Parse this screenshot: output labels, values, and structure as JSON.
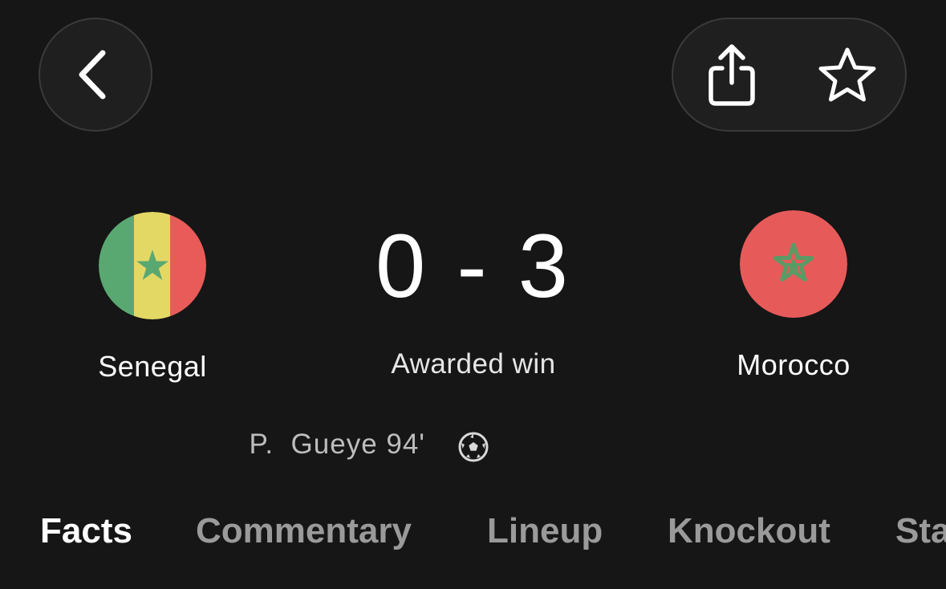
{
  "header": {
    "back_icon": "chevron-left-icon",
    "share_icon": "share-icon",
    "favorite_icon": "star-outline-icon"
  },
  "match": {
    "home_team": {
      "name": "Senegal",
      "flag": "senegal-flag"
    },
    "away_team": {
      "name": "Morocco",
      "flag": "morocco-flag"
    },
    "score": "0 - 3",
    "result_text": "Awarded win"
  },
  "events": {
    "scorer_text": "P.  Gueye 94'",
    "goal_icon": "soccer-ball-icon"
  },
  "tabs": [
    {
      "label": "Facts",
      "active": true
    },
    {
      "label": "Commentary",
      "active": false
    },
    {
      "label": "Lineup",
      "active": false
    },
    {
      "label": "Knockout",
      "active": false
    },
    {
      "label": "Stats",
      "active": false
    }
  ],
  "colors": {
    "background": "#161616",
    "button_fill": "#1f1f1f",
    "senegal_green": "#5aa871",
    "senegal_yellow": "#e4d865",
    "senegal_red": "#e85b58",
    "morocco_red": "#e65b59",
    "star_green": "#5a9b65",
    "inactive_tab": "#9a9a9a"
  }
}
